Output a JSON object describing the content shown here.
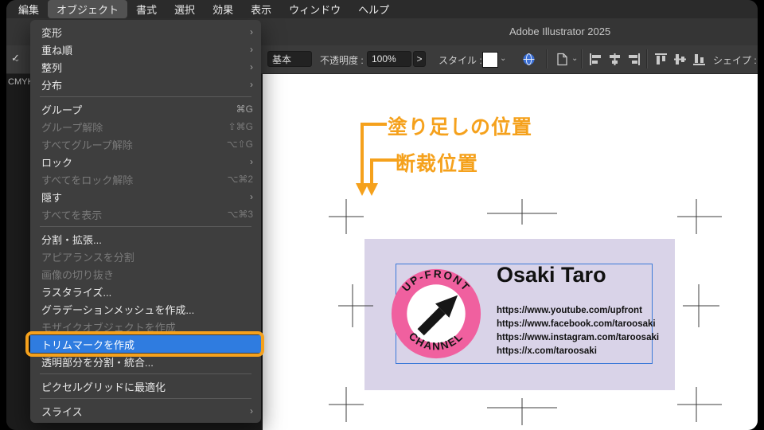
{
  "icons": {
    "check": "✓",
    "chevron_down": "⌄",
    "opacity_more": ">"
  },
  "menubar": {
    "items": [
      "編集",
      "オブジェクト",
      "書式",
      "選択",
      "効果",
      "表示",
      "ウィンドウ",
      "ヘルプ"
    ]
  },
  "titlebar": {
    "title": "Adobe Illustrator 2025"
  },
  "toolbar": {
    "preset": "基本",
    "opacity_label": "不透明度 :",
    "opacity_value": "100%",
    "style_label": "スタイル :",
    "shape_label": "シェイプ :"
  },
  "document": {
    "tab_fragment": "CMYK/"
  },
  "object_menu": {
    "items": [
      {
        "label": "変形",
        "trailing": "›",
        "state": "normal"
      },
      {
        "label": "重ね順",
        "trailing": "›",
        "state": "normal"
      },
      {
        "label": "整列",
        "trailing": "›",
        "state": "normal"
      },
      {
        "label": "分布",
        "trailing": "›",
        "state": "normal"
      },
      {
        "label": "グループ",
        "trailing": "⌘G",
        "state": "normal"
      },
      {
        "label": "グループ解除",
        "trailing": "⇧⌘G",
        "state": "disabled"
      },
      {
        "label": "すべてグループ解除",
        "trailing": "⌥⇧G",
        "state": "disabled"
      },
      {
        "label": "ロック",
        "trailing": "›",
        "state": "normal"
      },
      {
        "label": "すべてをロック解除",
        "trailing": "⌥⌘2",
        "state": "disabled"
      },
      {
        "label": "隠す",
        "trailing": "›",
        "state": "normal"
      },
      {
        "label": "すべてを表示",
        "trailing": "⌥⌘3",
        "state": "disabled"
      },
      {
        "label": "分割・拡張...",
        "trailing": "",
        "state": "normal"
      },
      {
        "label": "アピアランスを分割",
        "trailing": "",
        "state": "disabled"
      },
      {
        "label": "画像の切り抜き",
        "trailing": "",
        "state": "disabled"
      },
      {
        "label": "ラスタライズ...",
        "trailing": "",
        "state": "normal"
      },
      {
        "label": "グラデーションメッシュを作成...",
        "trailing": "",
        "state": "normal"
      },
      {
        "label": "モザイクオブジェクトを作成",
        "trailing": "",
        "state": "disabled"
      },
      {
        "label": "トリムマークを作成",
        "trailing": "",
        "state": "highlighted"
      },
      {
        "label": "透明部分を分割・統合...",
        "trailing": "",
        "state": "normal"
      },
      {
        "label": "ピクセルグリッドに最適化",
        "trailing": "",
        "state": "normal"
      },
      {
        "label": "スライス",
        "trailing": "›",
        "state": "normal"
      }
    ]
  },
  "callouts": {
    "bleed_label": "塗り足しの位置",
    "trim_label": "断裁位置",
    "accent_color": "#F5A11C"
  },
  "card": {
    "name": "Osaki Taro",
    "urls": [
      "https://www.youtube.com/upfront",
      "https://www.facebook.com/taroosaki",
      "https://www.instagram.com/taroosaki",
      "https://x.com/taroosaki"
    ],
    "logo": {
      "arc_top": "UP-FRONT",
      "arc_bottom": "CHANNEL"
    },
    "colors": {
      "bleed_background": "#D9D3E8",
      "finish_stroke": "#3C79D8",
      "logo_pink": "#F0609F"
    }
  }
}
